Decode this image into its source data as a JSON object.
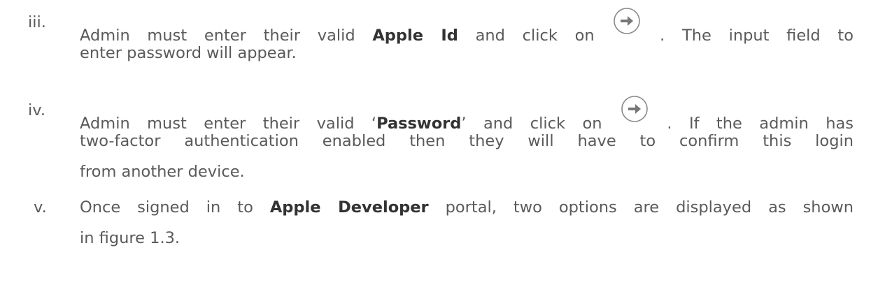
{
  "steps": [
    {
      "marker": "iii.",
      "lines": [
        {
          "pre": "Admin must enter their valid ",
          "bold": "Apple Id",
          "mid": " and click on",
          "post": ". The input field to"
        },
        {
          "text": "enter password will appear."
        }
      ]
    },
    {
      "marker": "iv.",
      "lines": [
        {
          "pre": "Admin must enter their valid ‘",
          "bold": "Password",
          "mid": "’ and click on",
          "post": ". If the admin has"
        },
        {
          "text": "two-factor authentication enabled then they will have to confirm this login"
        },
        {
          "text": "from another device."
        }
      ]
    },
    {
      "marker": "v.",
      "lines": [
        {
          "pre": "Once signed in to ",
          "bold": "Apple Developer",
          "post": " portal, two options are displayed as shown"
        },
        {
          "text": "in figure 1.3."
        }
      ]
    }
  ],
  "icons": {
    "arrow": "arrow-circle-right-icon",
    "stroke_color": "#888888",
    "arrow_color": "#777777"
  }
}
